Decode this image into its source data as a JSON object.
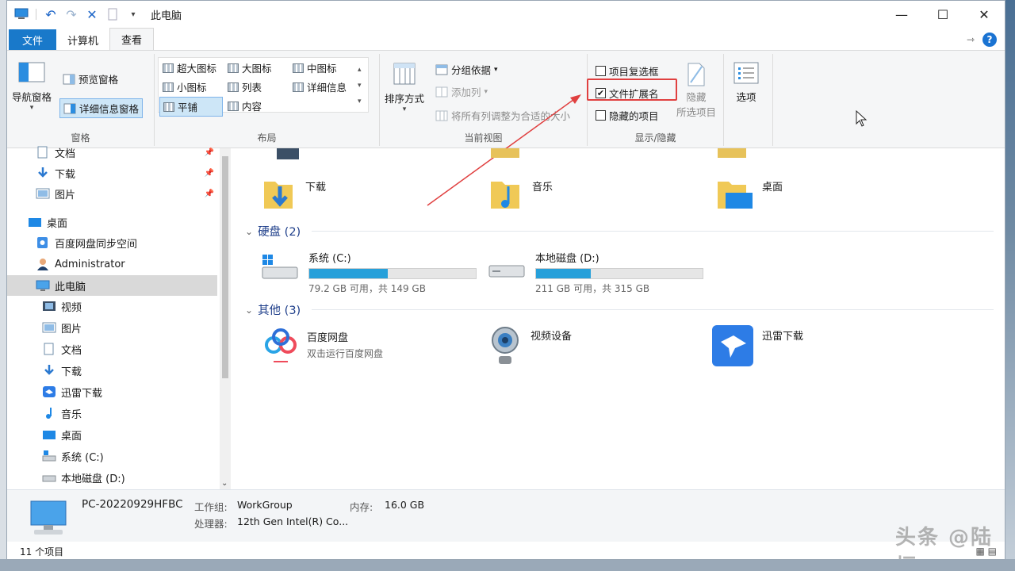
{
  "titlebar": {
    "title": "此电脑"
  },
  "tabs": {
    "file": "文件",
    "computer": "计算机",
    "view": "查看"
  },
  "ribbon": {
    "panes": {
      "nav_pane": "导航窗格",
      "preview_pane": "预览窗格",
      "details_pane": "详细信息窗格",
      "group": "窗格"
    },
    "layout": {
      "items": [
        "超大图标",
        "大图标",
        "中图标",
        "小图标",
        "列表",
        "详细信息",
        "平铺",
        "内容"
      ],
      "group": "布局"
    },
    "current_view": {
      "sort_by": "排序方式",
      "group_by": "分组依据",
      "add_column": "添加列",
      "fit_columns": "将所有列调整为合适的大小",
      "group": "当前视图"
    },
    "show_hide": {
      "item_checkboxes": "项目复选框",
      "item_checkboxes_checked": false,
      "file_extensions": "文件扩展名",
      "file_extensions_checked": true,
      "hidden_items": "隐藏的项目",
      "hidden_items_checked": false,
      "hide_selected_1": "隐藏",
      "hide_selected_2": "所选项目",
      "group": "显示/隐藏"
    },
    "options": "选项"
  },
  "nav": {
    "items": [
      {
        "label": "文档",
        "pinned": true
      },
      {
        "label": "下载",
        "pinned": true
      },
      {
        "label": "图片",
        "pinned": true
      },
      {
        "label": "桌面"
      },
      {
        "label": "百度网盘同步空间"
      },
      {
        "label": "Administrator"
      },
      {
        "label": "此电脑",
        "selected": true
      },
      {
        "label": "视频"
      },
      {
        "label": "图片"
      },
      {
        "label": "文档"
      },
      {
        "label": "下载"
      },
      {
        "label": "迅雷下载"
      },
      {
        "label": "音乐"
      },
      {
        "label": "桌面"
      },
      {
        "label": "系统 (C:)"
      },
      {
        "label": "本地磁盘 (D:)"
      }
    ]
  },
  "content": {
    "folders": [
      "下载",
      "音乐",
      "桌面"
    ],
    "drives_header": "硬盘 (2)",
    "drives": [
      {
        "name": "系统 (C:)",
        "info": "79.2 GB 可用，共 149 GB",
        "used_fraction": 0.47
      },
      {
        "name": "本地磁盘 (D:)",
        "info": "211 GB 可用，共 315 GB",
        "used_fraction": 0.33
      }
    ],
    "other_header": "其他 (3)",
    "others": [
      {
        "name": "百度网盘",
        "sub": "双击运行百度网盘"
      },
      {
        "name": "视频设备",
        "sub": ""
      },
      {
        "name": "迅雷下载",
        "sub": ""
      }
    ]
  },
  "details": {
    "pc_name": "PC-20220929HFBC",
    "workgroup_label": "工作组:",
    "workgroup_value": "WorkGroup",
    "memory_label": "内存:",
    "memory_value": "16.0 GB",
    "cpu_label": "处理器:",
    "cpu_value": "12th Gen Intel(R) Co..."
  },
  "status": {
    "count": "11 个项目"
  },
  "watermark": "头条 @陆桓",
  "colors": {
    "accent": "#1979ca",
    "highlight": "#e04040",
    "drive_fill": "#26a0da"
  }
}
